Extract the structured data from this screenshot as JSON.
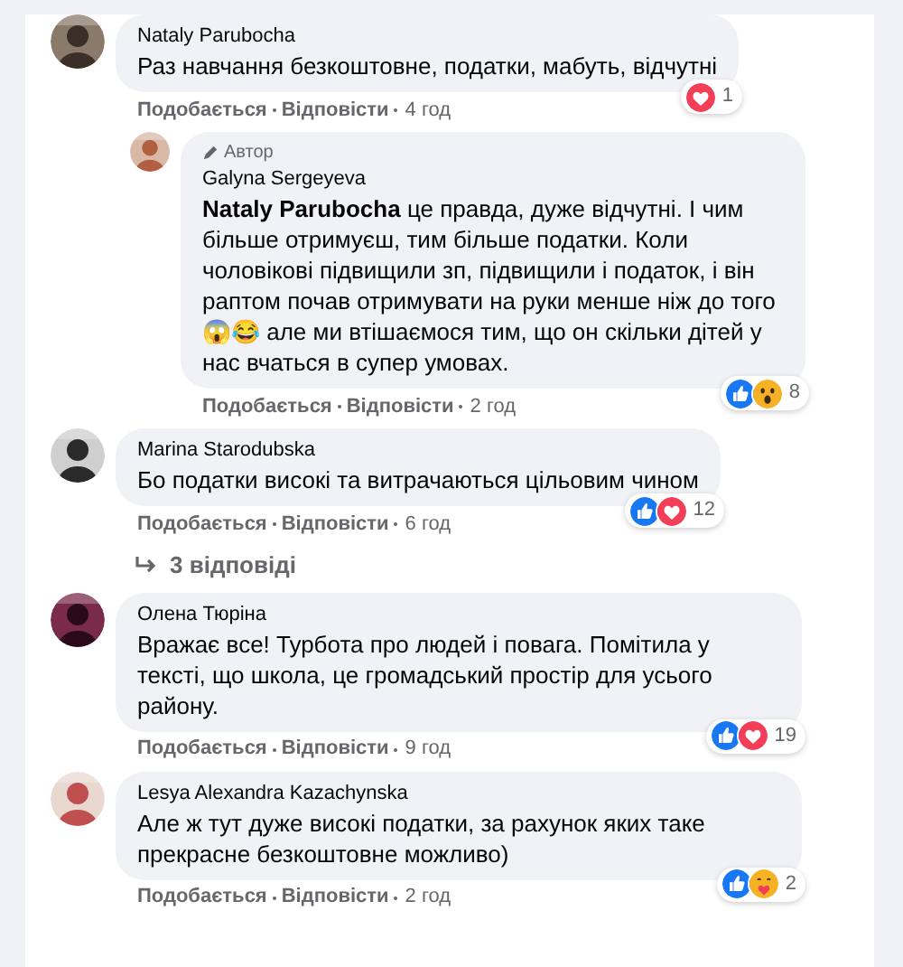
{
  "comments": [
    {
      "author": "Nataly Parubocha",
      "text": "Раз навчання безкоштовне, податки, мабуть, відчутні",
      "like": "Подобається",
      "reply": "Відповісти",
      "time": "4 год",
      "reactions": {
        "items": [
          {
            "kind": "love"
          }
        ],
        "count": "1"
      },
      "replies": [
        {
          "badge": "Автор",
          "author": "Galyna Sergeyeva",
          "text": "**Nataly Parubocha** це правда, дуже відчутні. І чим більше отримуєш, тим більше податки. Коли чоловікові підвищили зп, підвищили і податок, і він раптом почав отримувати на руки менше ніж до того 😱😂 але ми втішаємося тим, що он скільки дітей у нас вчаться в супер умовах.",
          "like": "Подобається",
          "reply": "Відповісти",
          "time": "2 год",
          "reactions": {
            "items": [
              {
                "kind": "like"
              },
              {
                "kind": "wow"
              }
            ],
            "count": "8"
          }
        }
      ]
    },
    {
      "author": "Marina Starodubska",
      "text": "Бо податки високі та витрачаються цільовим чином",
      "like": "Подобається",
      "reply": "Відповісти",
      "time": "6 год",
      "reactions": {
        "items": [
          {
            "kind": "like"
          },
          {
            "kind": "love"
          }
        ],
        "count": "12"
      },
      "more_replies": "3 відповіді"
    },
    {
      "author": "Олена Тюріна",
      "text": "Вражає все! Турбота про людей і повага. Помітила у тексті, що школа, це громадський простір для усього району.",
      "like": "Подобається",
      "reply": "Відповісти",
      "time": "9 год",
      "reactions": {
        "items": [
          {
            "kind": "like"
          },
          {
            "kind": "love"
          }
        ],
        "count": "19"
      }
    },
    {
      "author": "Lesya Alexandra Kazachynska",
      "text": "Але ж тут дуже високі податки, за рахунок яких таке прекрасне безкоштовне можливо)",
      "like": "Подобається",
      "reply": "Відповісти",
      "time": "2 год",
      "reactions": {
        "items": [
          {
            "kind": "like"
          },
          {
            "kind": "care"
          }
        ],
        "count": "2"
      }
    }
  ]
}
